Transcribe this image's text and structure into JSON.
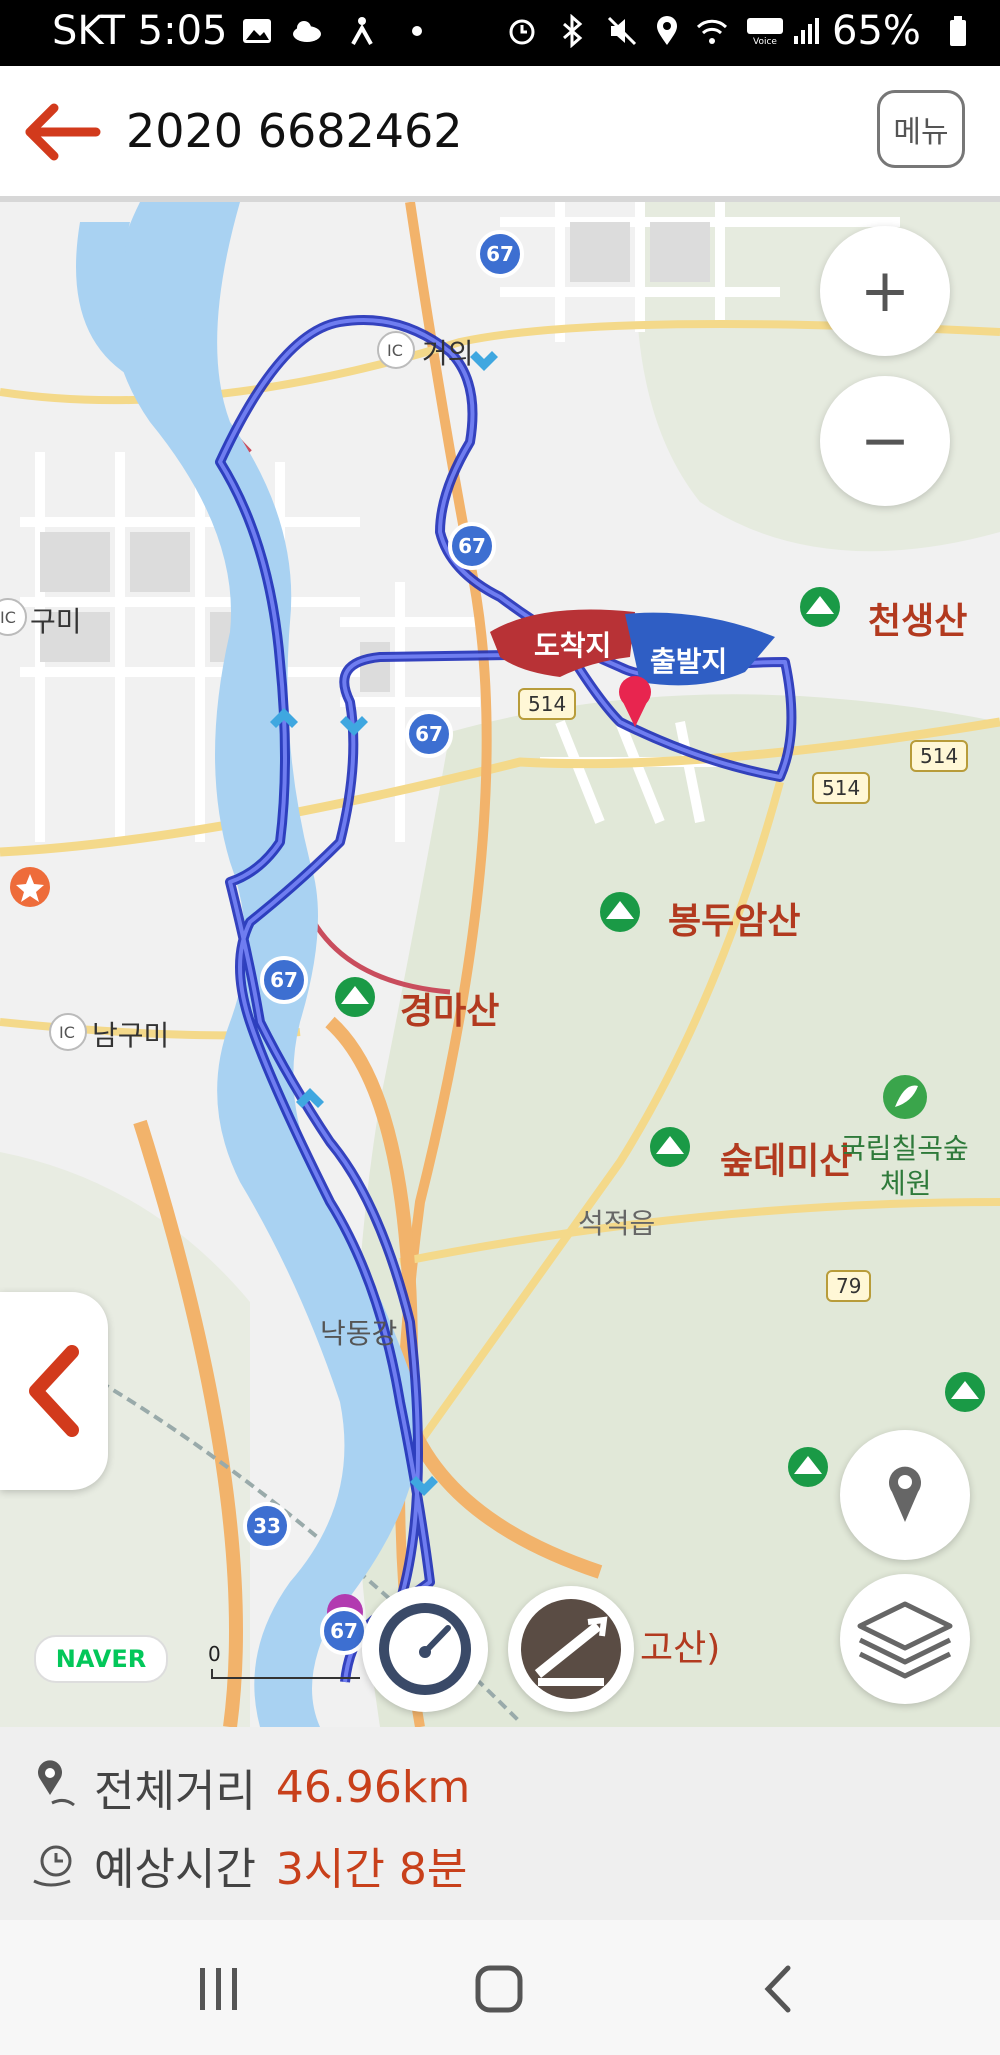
{
  "status_bar": {
    "carrier_time": "SKT 5:05",
    "battery": "65%"
  },
  "header": {
    "title": "2020 6682462",
    "menu_label": "메뉴"
  },
  "map": {
    "places": {
      "cheonsaengsan": "천생산",
      "bongduamsan": "봉두암산",
      "gyeongmasan": "경마산",
      "supdemisan": "숲데미산",
      "forest_line1": "국립칠곡숲",
      "forest_line2": "체원",
      "seokjeok": "석적읍",
      "nakdonggang": "낙동강",
      "gumi": "구미",
      "geoui": "거의",
      "namgumi": "남구미",
      "gosan": "고산)"
    },
    "markers": {
      "arrival": "도착지",
      "departure": "출발지"
    },
    "roads": {
      "r67": "67",
      "r514": "514",
      "r79": "79",
      "r33": "33"
    },
    "scale_zero": "0",
    "naver_logo": "NAVER"
  },
  "summary": {
    "distance_label": "전체거리",
    "distance_value": "46.96km",
    "time_label": "예상시간",
    "time_value": "3시간 8분"
  },
  "colors": {
    "accent": "#c8401b",
    "route": "#2a3ec6",
    "river": "#a9d2f2",
    "forest": "#dde5d4"
  }
}
